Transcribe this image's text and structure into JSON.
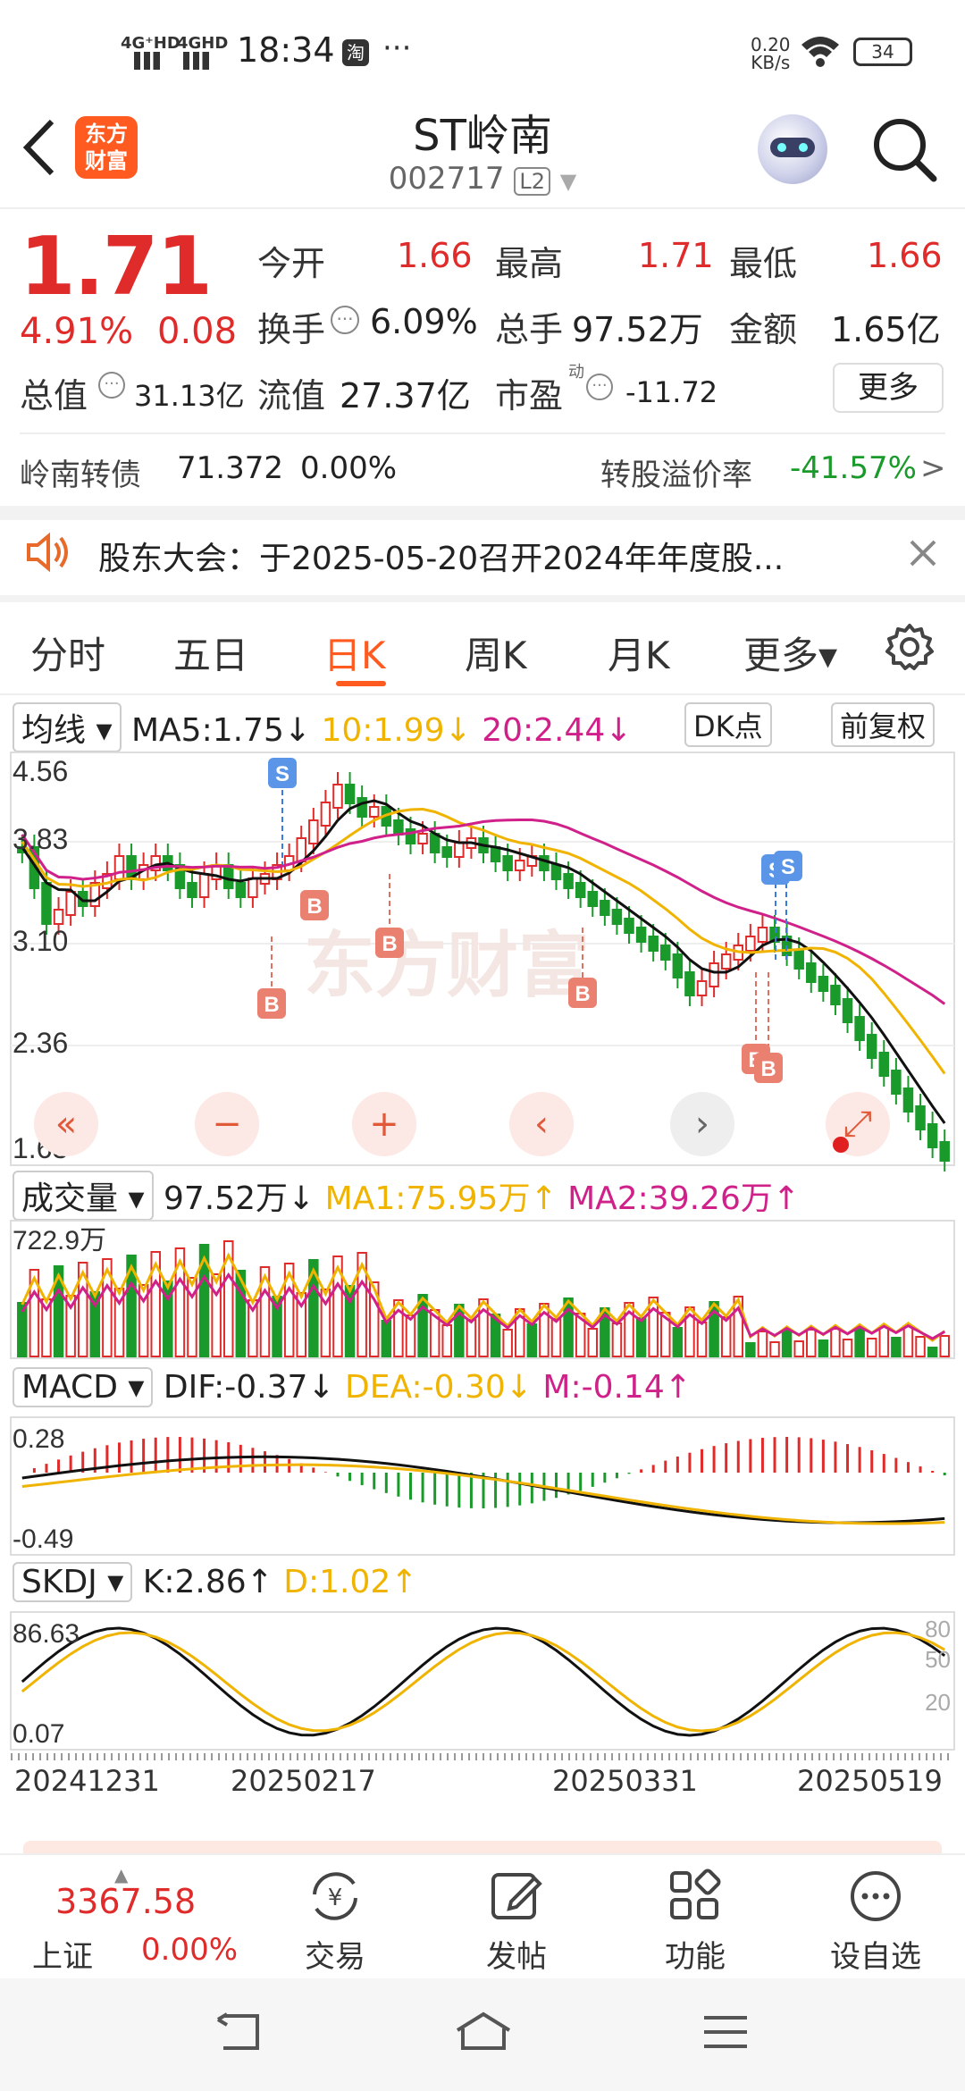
{
  "status_bar": {
    "network1": "4G⁺HD",
    "network2": "4GHD",
    "time": "18:34",
    "app_icon": "淘",
    "dots": "···",
    "speed_value": "0.20",
    "speed_unit": "KB/s",
    "battery": "34"
  },
  "header": {
    "title": "ST岭南",
    "code": "002717",
    "level_badge": "L2",
    "logo_line1": "东方",
    "logo_line2": "财富"
  },
  "quote": {
    "price": "1.71",
    "change_pct": "4.91%",
    "change": "0.08",
    "open_label": "今开",
    "open": "1.66",
    "high_label": "最高",
    "high": "1.71",
    "low_label": "最低",
    "low": "1.66",
    "turnover_label": "换手",
    "turnover": "6.09%",
    "volume_label": "总手",
    "volume": "97.52万",
    "amount_label": "金额",
    "amount": "1.65亿",
    "mktcap_label": "总值",
    "mktcap": "31.13亿",
    "float_label": "流值",
    "float": "27.37亿",
    "pe_label": "市盈",
    "pe_sup": "动",
    "pe": "-11.72",
    "more_btn": "更多"
  },
  "bond": {
    "name": "岭南转债",
    "price": "71.372",
    "change": "0.00%",
    "premium_label": "转股溢价率",
    "premium": "-41.57%",
    "arrow": ">"
  },
  "notice": {
    "text": "股东大会：于2025-05-20召开2024年年度股..."
  },
  "tabs": [
    "分时",
    "五日",
    "日K",
    "周K",
    "月K",
    "更多▾"
  ],
  "active_tab": 2,
  "ma_row": {
    "dropdown": "均线",
    "ma5": "MA5:1.75↓",
    "ma10": "10:1.99↓",
    "ma20": "20:2.44↓",
    "dk_btn": "DK点",
    "fq_btn": "前复权"
  },
  "kline_axis": [
    "4.56",
    "3.83",
    "3.10",
    "2.36",
    "1.63"
  ],
  "vol_row": {
    "dropdown": "成交量",
    "vol": "97.52万↓",
    "ma1": "MA1:75.95万↑",
    "ma2": "MA2:39.26万↑"
  },
  "vol_axis": "722.9万",
  "macd_row": {
    "dropdown": "MACD",
    "dif": "DIF:-0.37↓",
    "dea": "DEA:-0.30↓",
    "m": "M:-0.14↑"
  },
  "macd_axis": [
    "0.28",
    "-0.49"
  ],
  "kdj_row": {
    "dropdown": "SKDJ",
    "k": "K:2.86↑",
    "d": "D:1.02↑"
  },
  "kdj_axis": [
    "86.63",
    "0.07"
  ],
  "kdj_right_axis": [
    "80",
    "50",
    "20"
  ],
  "dates": [
    "20241231",
    "20250217",
    "20250331",
    "20250519"
  ],
  "markers": {
    "s": "S",
    "b": "B"
  },
  "watermark": "东方财富",
  "bottom_nav": {
    "index_value": "3367.58",
    "index_name": "上证",
    "index_change": "0.00%",
    "trade": "交易",
    "post": "发帖",
    "function": "功能",
    "watch": "设自选"
  },
  "colors": {
    "up": "#e02b2b",
    "down": "#1a9a2a",
    "ma10": "#f0b400",
    "ma20": "#d0208a",
    "accent": "#ff5a1f"
  }
}
